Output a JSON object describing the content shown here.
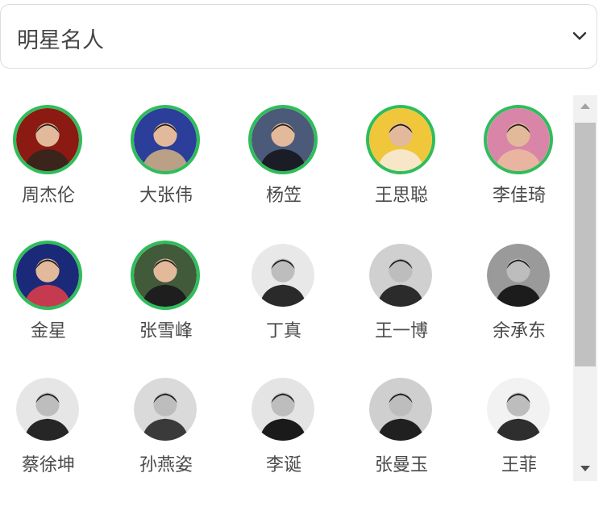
{
  "dropdown": {
    "selected": "明星名人",
    "icon": "chevron-down-icon"
  },
  "accent_color": "#2fbd5a",
  "celebrities": [
    {
      "name": "周杰伦",
      "selected": true,
      "colors": [
        "#8a1a12",
        "#3a241c"
      ]
    },
    {
      "name": "大张伟",
      "selected": true,
      "colors": [
        "#2a3e9a",
        "#b9a087"
      ]
    },
    {
      "name": "杨笠",
      "selected": true,
      "colors": [
        "#4a5a78",
        "#1a1d26"
      ]
    },
    {
      "name": "王思聪",
      "selected": true,
      "colors": [
        "#f0c63a",
        "#f7e6c8"
      ]
    },
    {
      "name": "李佳琦",
      "selected": true,
      "colors": [
        "#d985a8",
        "#e9b4a0"
      ]
    },
    {
      "name": "金星",
      "selected": true,
      "colors": [
        "#1b2a78",
        "#c63a50"
      ]
    },
    {
      "name": "张雪峰",
      "selected": true,
      "colors": [
        "#405a3a",
        "#1e1e1e"
      ]
    },
    {
      "name": "丁真",
      "selected": false,
      "colors": [
        "#e8e8e8",
        "#2a2a2a"
      ]
    },
    {
      "name": "王一博",
      "selected": false,
      "colors": [
        "#d0d0d0",
        "#2b2b2b"
      ]
    },
    {
      "name": "余承东",
      "selected": false,
      "colors": [
        "#9a9a9a",
        "#1c1c1c"
      ]
    },
    {
      "name": "蔡徐坤",
      "selected": false,
      "colors": [
        "#e6e6e6",
        "#262626"
      ]
    },
    {
      "name": "孙燕姿",
      "selected": false,
      "colors": [
        "#dadada",
        "#3a3a3a"
      ]
    },
    {
      "name": "李诞",
      "selected": false,
      "colors": [
        "#e4e4e4",
        "#1a1a1a"
      ]
    },
    {
      "name": "张曼玉",
      "selected": false,
      "colors": [
        "#cfcfcf",
        "#202020"
      ]
    },
    {
      "name": "王菲",
      "selected": false,
      "colors": [
        "#f2f2f2",
        "#2e2e2e"
      ]
    }
  ]
}
